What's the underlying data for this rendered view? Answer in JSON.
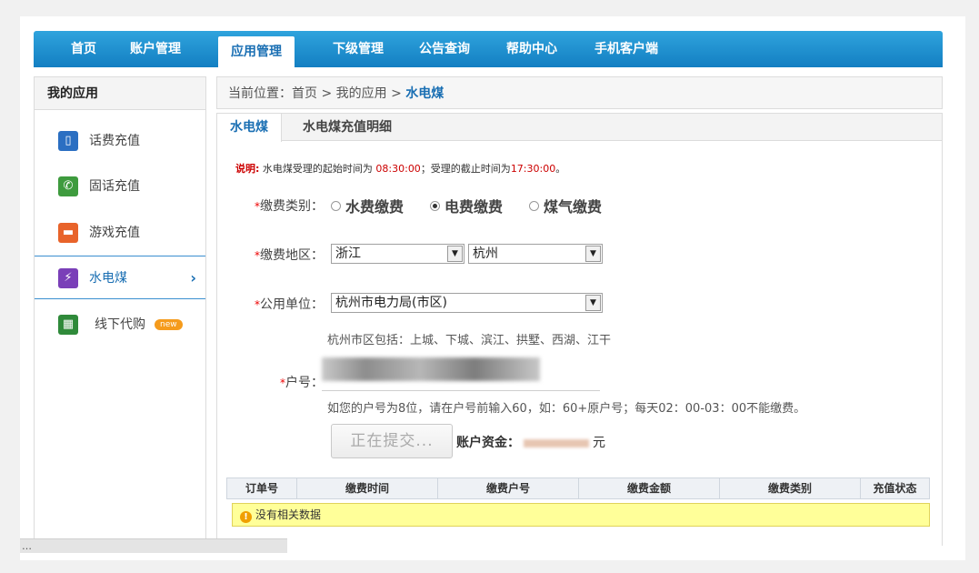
{
  "nav": {
    "items": [
      {
        "label": "首页"
      },
      {
        "label": "账户管理"
      },
      {
        "label": "应用管理"
      },
      {
        "label": "下级管理"
      },
      {
        "label": "公告查询"
      },
      {
        "label": "帮助中心"
      },
      {
        "label": "手机客户端"
      }
    ],
    "active_index": 2
  },
  "sidebar": {
    "title": "我的应用",
    "items": [
      {
        "label": "话费充值",
        "icon": "phone-icon"
      },
      {
        "label": "固话充值",
        "icon": "telephone-icon"
      },
      {
        "label": "游戏充值",
        "icon": "gamepad-icon"
      },
      {
        "label": "水电煤",
        "icon": "utility-icon"
      },
      {
        "label": "线下代购",
        "icon": "cart-icon",
        "badge": "new"
      }
    ],
    "active_index": 3
  },
  "breadcrumb": {
    "prefix": "当前位置：首页 > 我的应用 > ",
    "current": "水电煤"
  },
  "tabs": [
    {
      "label": "水电煤"
    },
    {
      "label": "水电煤充值明细"
    }
  ],
  "note": {
    "lead": "说明:",
    "t1": " 水电煤受理的起始时间为 ",
    "start": "08:30:00",
    "t2": "；受理的截止时间为",
    "end": "17:30:00",
    "t3": "。"
  },
  "form": {
    "type_label": "缴费类别：",
    "type_options": [
      "水费缴费",
      "电费缴费",
      "煤气缴费"
    ],
    "type_selected": 1,
    "region_label": "缴费地区：",
    "province": "浙江",
    "city": "杭州",
    "unit_label": "公用单位：",
    "unit": "杭州市电力局(市区)",
    "unit_hint": "杭州市区包括：上城、下城、滨江、拱墅、西湖、江干",
    "account_label": "户号：",
    "account_hint": "如您的户号为8位，请在户号前输入60，如：60+原户号；每天02：00-03：00不能缴费。",
    "submit_label": "正在提交...",
    "funds_label": "账户资金：",
    "funds_unit": "元",
    "required_mark": "*"
  },
  "table": {
    "columns": [
      "订单号",
      "缴费时间",
      "缴费户号",
      "缴费金额",
      "缴费类别",
      "充值状态"
    ],
    "empty_text": "没有相关数据"
  },
  "status_bar": {
    "text": "…"
  },
  "colors": {
    "nav_blue": "#137fc2",
    "accent": "#1a6fb3",
    "required": "#e00000",
    "empty_bg": "#ffff99"
  }
}
